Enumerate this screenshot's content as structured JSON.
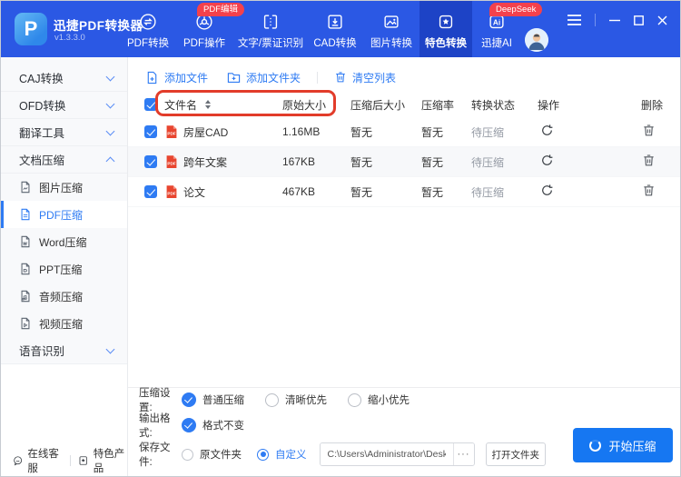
{
  "app": {
    "name": "迅捷PDF转换器",
    "version": "v1.3.3.0"
  },
  "header": {
    "nav": [
      {
        "label": "PDF转换"
      },
      {
        "label": "PDF操作",
        "badge": "PDF编辑"
      },
      {
        "label": "文字/票证识别"
      },
      {
        "label": "CAD转换"
      },
      {
        "label": "图片转换"
      },
      {
        "label": "特色转换",
        "active": true
      },
      {
        "label": "迅捷AI",
        "badge": "DeepSeek"
      }
    ]
  },
  "sidebar": {
    "groups": [
      "CAJ转换",
      "OFD转换",
      "翻译工具",
      "文档压缩",
      "语音识别"
    ],
    "subs": [
      "图片压缩",
      "PDF压缩",
      "Word压缩",
      "PPT压缩",
      "音频压缩",
      "视频压缩"
    ],
    "selected_sub": "PDF压缩"
  },
  "toolbar": {
    "add_file": "添加文件",
    "add_folder": "添加文件夹",
    "clear_list": "清空列表"
  },
  "table": {
    "headers": {
      "name": "文件名",
      "original": "原始大小",
      "compressed": "压缩后大小",
      "ratio": "压缩率",
      "status": "转换状态",
      "action": "操作",
      "delete": "删除"
    },
    "rows": [
      {
        "name": "房屋CAD",
        "original": "1.16MB",
        "compressed": "暂无",
        "ratio": "暂无",
        "status": "待压缩"
      },
      {
        "name": "跨年文案",
        "original": "167KB",
        "compressed": "暂无",
        "ratio": "暂无",
        "status": "待压缩"
      },
      {
        "name": "论文",
        "original": "467KB",
        "compressed": "暂无",
        "ratio": "暂无",
        "status": "待压缩"
      }
    ]
  },
  "settings": {
    "compression": {
      "label": "压缩设置:",
      "options": [
        {
          "label": "普通压缩",
          "selected": true
        },
        {
          "label": "清晰优先",
          "selected": false
        },
        {
          "label": "缩小优先",
          "selected": false
        }
      ]
    },
    "output": {
      "label": "输出格式:",
      "options": [
        {
          "label": "格式不变",
          "selected": true
        }
      ]
    },
    "save": {
      "label": "保存文件:",
      "options": [
        {
          "label": "原文件夹",
          "selected": false
        },
        {
          "label": "自定义",
          "selected": true
        }
      ],
      "path": "C:\\Users\\Administrator\\Desktop",
      "more": "···",
      "open_folder": "打开文件夹"
    }
  },
  "footer": {
    "online_service": "在线客服",
    "featured": "特色产品",
    "start": "开始压缩"
  },
  "colors": {
    "header_blue": "#2b58e4",
    "active_tab_blue": "#1d43c6",
    "accent_blue": "#2e7bf3",
    "badge_red": "#f4414c",
    "pdf_icon_red": "#e8452f",
    "annotation_red": "#e23c2a",
    "start_button_blue": "#1677f2",
    "status_gray": "#949aa4"
  }
}
